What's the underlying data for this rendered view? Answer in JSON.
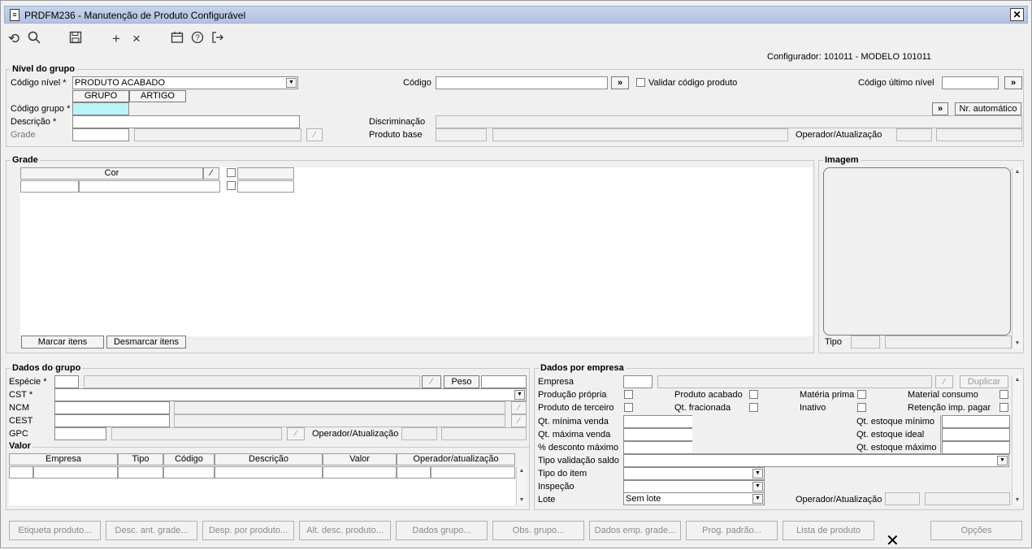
{
  "window": {
    "title": "PRDFM236 - Manutenção de Produto Configurável",
    "close": "✕"
  },
  "configurador": "Configurador: 101011 - MODELO 101011",
  "nivel": {
    "title": "Nível do grupo",
    "codigo_nivel_label": "Código nível *",
    "codigo_nivel_value": "PRODUTO ACABADO",
    "tab_grupo": "GRUPO",
    "tab_artigo": "ARTIGO",
    "codigo_grupo_label": "Código grupo *",
    "descricao_label": "Descrição *",
    "grade_label": "Grade",
    "codigo_label": "Código",
    "validar_label": "Validar código produto",
    "codigo_ultimo_label": "Código último nível",
    "discriminacao_label": "Discriminação",
    "produto_base_label": "Produto base",
    "operador_label": "Operador/Atualização",
    "nr_automatico": "Nr. automático",
    "arrow": "»"
  },
  "grade": {
    "title": "Grade",
    "cor_header": "Cor",
    "marcar": "Marcar itens",
    "desmarcar": "Desmarcar itens"
  },
  "imagem": {
    "title": "Imagem",
    "tipo_label": "Tipo"
  },
  "dados_grupo": {
    "title": "Dados do grupo",
    "especie": "Espécie *",
    "peso": "Peso",
    "cst": "CST *",
    "ncm": "NCM",
    "cest": "CEST",
    "gpc": "GPC",
    "operador": "Operador/Atualização"
  },
  "valor": {
    "title": "Valor",
    "columns": [
      "Empresa",
      "Tipo",
      "Código",
      "Descrição",
      "Valor",
      "Operador/atualização"
    ]
  },
  "dados_empresa": {
    "title": "Dados por empresa",
    "empresa": "Empresa",
    "duplicar": "Duplicar",
    "producao_propria": "Produção própria",
    "produto_acabado": "Produto acabado",
    "materia_prima": "Matéria prima",
    "material_consumo": "Material consumo",
    "produto_terceiro": "Produto de terceiro",
    "qt_fracionada": "Qt. fracionada",
    "inativo": "Inativo",
    "retencao": "Retenção imp. pagar",
    "qt_min_venda": "Qt. mínima venda",
    "qt_max_venda": "Qt. máxima venda",
    "desc_max": "% desconto máximo",
    "qt_est_min": "Qt. estoque mínimo",
    "qt_est_ideal": "Qt. estoque ideal",
    "qt_est_max": "Qt. estoque máximo",
    "tipo_validacao": "Tipo validação saldo",
    "tipo_item": "Tipo do item",
    "inspecao": "Inspeção",
    "lote": "Lote",
    "lote_value": "Sem lote",
    "operador": "Operador/Atualização"
  },
  "bottom_buttons": [
    "Etiqueta produto...",
    "Desc. ant. grade...",
    "Desp. por produto...",
    "Alt. desc. produto...",
    "Dados grupo...",
    "Obs. grupo...",
    "Dados emp. grade...",
    "Prog. padrão...",
    "Lista de produto",
    "Opções"
  ],
  "icons": {
    "undo": "⟲",
    "search": "⚲",
    "save": "🖫",
    "add": "+",
    "delete": "×",
    "calendar": "▦",
    "help": "?",
    "exit": "↦",
    "cursor": "✕",
    "dropdown": "▼",
    "up": "▲",
    "wand": "⁄"
  }
}
